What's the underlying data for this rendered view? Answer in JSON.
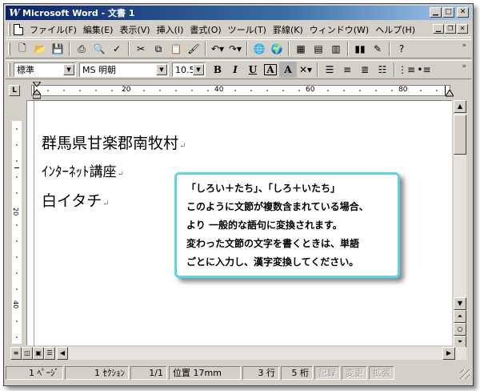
{
  "window": {
    "title": "Microsoft Word - 文書 1",
    "app_icon": "W",
    "caption_buttons": [
      "minimize-icon",
      "maximize-icon",
      "close-icon"
    ]
  },
  "menu": {
    "items": [
      "ファイル(F)",
      "編集(E)",
      "表示(V)",
      "挿入(I)",
      "書式(O)",
      "ツール(T)",
      "罫線(K)",
      "ウィンドウ(W)",
      "ヘルプ(H)"
    ]
  },
  "toolbar_format": {
    "style_value": "標準",
    "font_value": "MS 明朝",
    "size_value": "10.5",
    "bold": "B",
    "italic": "I",
    "underline": "U",
    "border_char": "A",
    "shade_char": "A"
  },
  "ruler": {
    "tab_selector": "L",
    "h_labels": [
      "20",
      "40",
      "60",
      "80"
    ],
    "v_labels": [
      "20",
      "40"
    ]
  },
  "document": {
    "lines": [
      "群馬県甘楽郡南牧村",
      "ｲﾝﾀｰﾈｯﾄ講座",
      "白イタチ"
    ],
    "paragraph_mark": "↵"
  },
  "callout": {
    "lines": [
      "「しろい＋たち」、「しろ＋いたち」",
      "このように文節が複数含まれている場合、",
      "より 一般的な語句に変換されます。",
      "変わった文節の文字を書くときは、単語",
      "ごとに入力し、漢字変換してください。"
    ],
    "border_color": "#5fd3e6"
  },
  "status": {
    "page": "1 ﾍﾟｰｼﾞ",
    "section": "1 ｾｸｼｮﾝ",
    "pages": "1/1",
    "position": "位置 17mm",
    "line": "3 行",
    "column": "5 桁",
    "rec": "記録",
    "trk": "変更",
    "ext": "拡張"
  },
  "colors": {
    "titlebar_start": "#0a246a",
    "titlebar_end": "#a6caf0",
    "chrome": "#d4d0c8"
  }
}
